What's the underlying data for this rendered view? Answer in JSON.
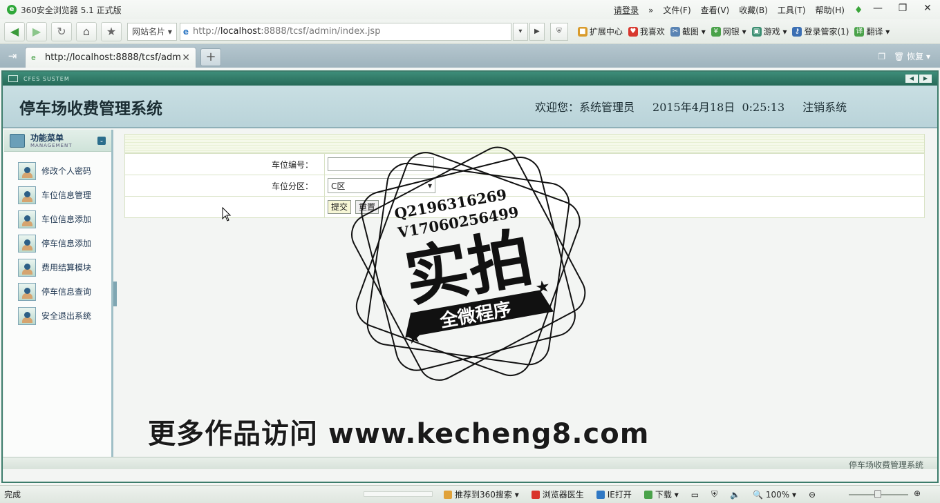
{
  "browser": {
    "title": "360安全浏览器 5.1 正式版",
    "login": "请登录",
    "menus": [
      "文件(F)",
      "查看(V)",
      "收藏(B)",
      "工具(T)",
      "帮助(H)"
    ],
    "namecard": "网站名片",
    "address": {
      "scheme": "http://",
      "host": "localhost",
      "rest": ":8888/tcsf/admin/index.jsp"
    },
    "toolbar_items": [
      "扩展中心",
      "我喜欢",
      "截图",
      "网银",
      "游戏",
      "登录管家(1)",
      "翻译"
    ],
    "tab_title": "http://localhost:8888/tcsf/admin...",
    "restore": "恢复"
  },
  "app": {
    "strip_label": "CFES SUSTEM",
    "system_title": "停车场收费管理系统",
    "welcome": "欢迎您：系统管理员",
    "datetime": "2015年4月18日  0:25:13",
    "logout": "注销系统",
    "menu": {
      "title": "功能菜单",
      "subtitle": "MANAGEMENT",
      "items": [
        "修改个人密码",
        "车位信息管理",
        "车位信息添加",
        "停车信息添加",
        "费用结算模块",
        "停车信息查询",
        "安全退出系统"
      ]
    },
    "form": {
      "space_no_label": "车位编号：",
      "space_no_value": "",
      "zone_label": "车位分区：",
      "zone_value": "C区",
      "submit": "提交",
      "reset": "重置"
    },
    "footer": "停车场收费管理系统"
  },
  "watermark": {
    "qq": "Q2196316269",
    "wechat": "V17060256499",
    "big": "实拍",
    "banner": "全微程序",
    "site_line": "更多作品访问 www.kecheng8.com"
  },
  "status": {
    "done": "完成",
    "items": [
      "推荐到360搜索",
      "浏览器医生",
      "IE打开",
      "下载"
    ],
    "zoom": "100%"
  }
}
